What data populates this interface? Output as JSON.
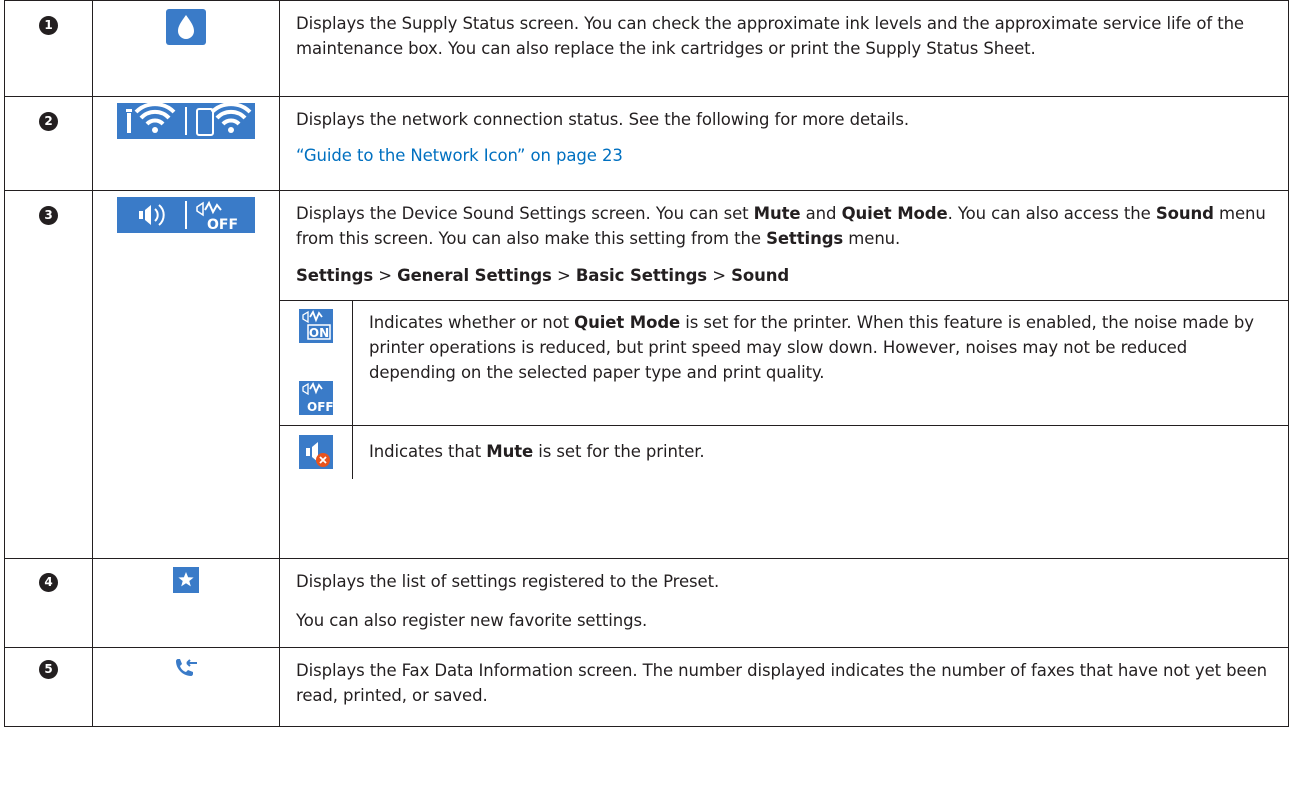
{
  "rows": [
    {
      "number": "1",
      "icon": "ink-drop-icon",
      "text": "Displays the Supply Status screen. You can check the approximate ink levels and the approximate service life of the maintenance box. You can also replace the ink cartridges or print the Supply Status Sheet."
    },
    {
      "number": "2",
      "icon": "network-status-icons",
      "text": "Displays the network connection status. See the following for more details.",
      "link": "“Guide to the Network Icon” on page 23"
    },
    {
      "number": "3",
      "icon": "sound-status-icons",
      "text_parts": [
        "Displays the Device Sound Settings screen. You can set ",
        "Mute",
        " and ",
        "Quiet Mode",
        ". You can also access the ",
        "Sound",
        " menu from this screen. You can also make this setting from the ",
        "Settings",
        " menu."
      ],
      "path": [
        "Settings",
        "General Settings",
        "Basic Settings",
        "Sound"
      ],
      "path_separator": ">",
      "sub_rows": [
        {
          "icons": [
            "quiet-mode-on-icon",
            "quiet-mode-off-icon"
          ],
          "icon_labels": [
            "ON",
            "OFF"
          ],
          "text_parts": [
            "Indicates whether or not ",
            "Quiet Mode",
            " is set for the printer. When this feature is enabled, the noise made by printer operations is reduced, but print speed may slow down. However, noises may not be reduced depending on the selected paper type and print quality."
          ]
        },
        {
          "icons": [
            "mute-icon"
          ],
          "text_parts": [
            "Indicates that ",
            "Mute",
            " is set for the printer."
          ]
        }
      ]
    },
    {
      "number": "4",
      "icon": "star-preset-icon",
      "text": "Displays the list of settings registered to the Preset.",
      "text2": "You can also register new favorite settings."
    },
    {
      "number": "5",
      "icon": "fax-data-icon",
      "text": "Displays the Fax Data Information screen. The number displayed indicates the number of faxes that have not yet been read, printed, or saved."
    }
  ],
  "colors": {
    "icon_blue": "#3a7bc8",
    "link_blue": "#0070c0",
    "text": "#231f20"
  }
}
